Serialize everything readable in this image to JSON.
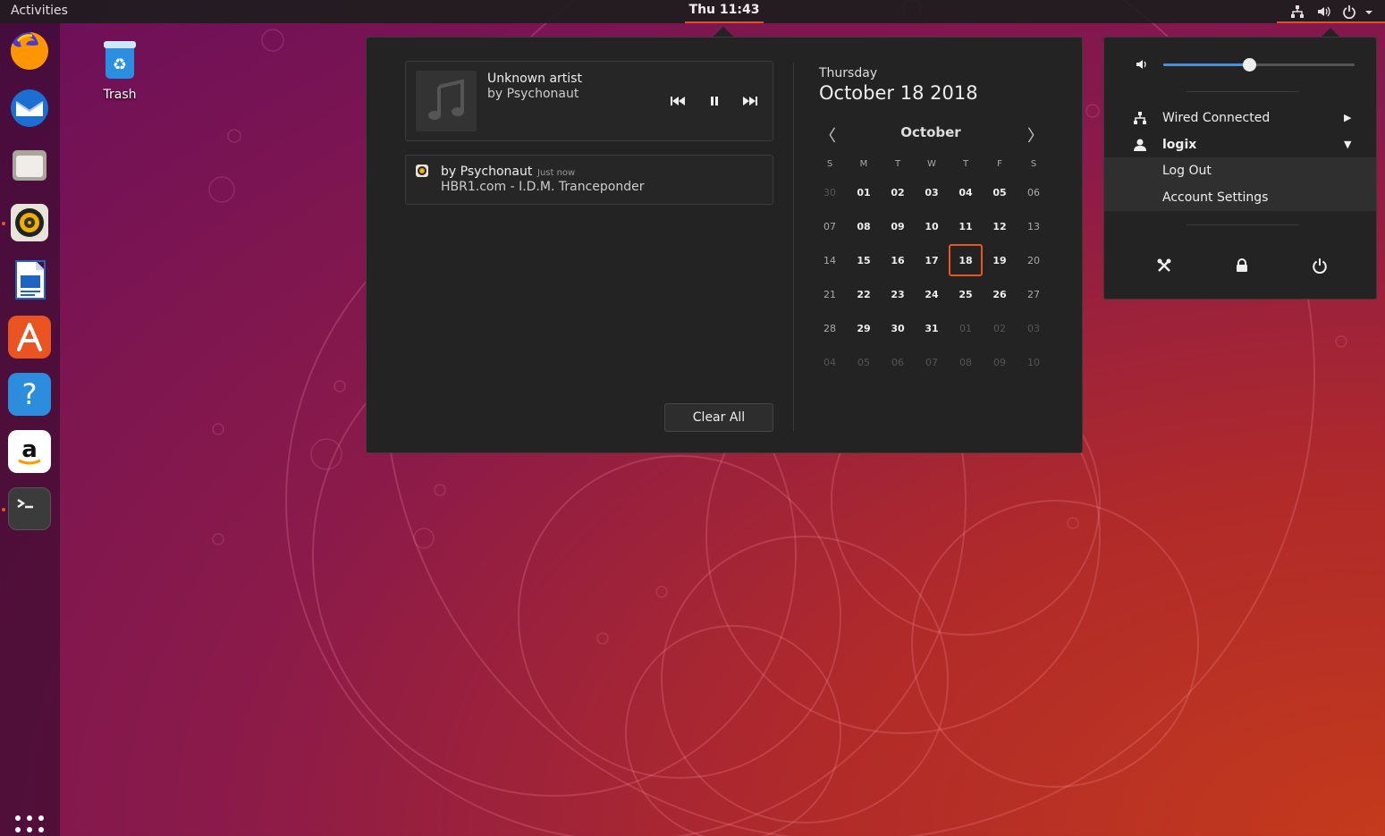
{
  "topbar": {
    "activities_label": "Activities",
    "clock": "Thu 11:43"
  },
  "desktop": {
    "trash_label": "Trash"
  },
  "dock": {
    "items": [
      "firefox-icon",
      "thunderbird-icon",
      "files-icon",
      "rhythmbox-icon",
      "libreoffice-writer-icon",
      "ubuntu-software-icon",
      "help-icon",
      "amazon-icon",
      "terminal-icon"
    ]
  },
  "media": {
    "title": "Unknown artist",
    "artist": "by Psychonaut"
  },
  "notification": {
    "title": "by Psychonaut",
    "time": "Just now",
    "body": "HBR1.com - I.D.M. Tranceponder"
  },
  "clear_all_label": "Clear All",
  "calendar": {
    "weekday": "Thursday",
    "date": "October 18 2018",
    "month": "October",
    "prev": "〈",
    "next": "〉",
    "day_headers": [
      "S",
      "M",
      "T",
      "W",
      "T",
      "F",
      "S"
    ],
    "weeks": [
      [
        "30",
        "01",
        "02",
        "03",
        "04",
        "05",
        "06"
      ],
      [
        "07",
        "08",
        "09",
        "10",
        "11",
        "12",
        "13"
      ],
      [
        "14",
        "15",
        "16",
        "17",
        "18",
        "19",
        "20"
      ],
      [
        "21",
        "22",
        "23",
        "24",
        "25",
        "26",
        "27"
      ],
      [
        "28",
        "29",
        "30",
        "31",
        "01",
        "02",
        "03"
      ],
      [
        "04",
        "05",
        "06",
        "07",
        "08",
        "09",
        "10"
      ]
    ],
    "today": "18"
  },
  "system_menu": {
    "volume_level": 0.45,
    "network_label": "Wired Connected",
    "user_label": "logix",
    "logout_label": "Log Out",
    "account_settings_label": "Account Settings"
  },
  "colors": {
    "accent": "#e95420",
    "slider": "#4a90d9"
  }
}
